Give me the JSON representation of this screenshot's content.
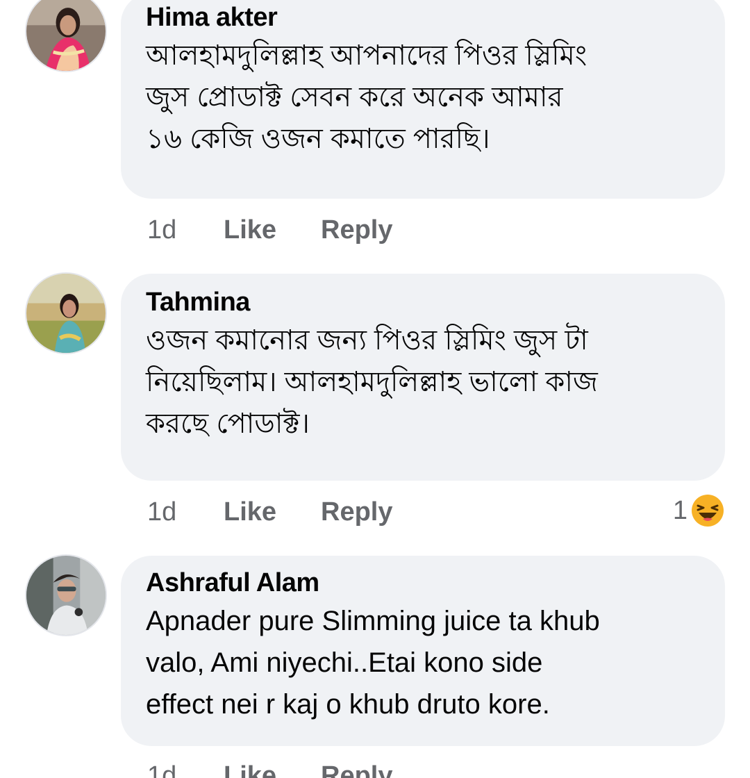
{
  "comments": [
    {
      "author": "Hima akter",
      "text": "আলহামদুলিল্লাহ আপনাদের পিওর স্লিমিং\nজুস প্রোডাক্ট সেবন করে অনেক আমার\n১৬ কেজি ওজন কমাতে পারছি।",
      "time": "1d",
      "like_label": "Like",
      "reply_label": "Reply"
    },
    {
      "author": "Tahmina",
      "text": "ওজন কমানোর জন্য পিওর স্লিমিং জুস টা\nনিয়েছিলাম। আলহামদুলিল্লাহ ভালো কাজ\nকরছে পোডাক্ট।",
      "time": "1d",
      "like_label": "Like",
      "reply_label": "Reply",
      "reaction_count": "1",
      "reaction_icon": "haha-emoji-icon"
    },
    {
      "author": "Ashraful Alam",
      "text": "Apnader pure Slimming  juice ta khub\nvalo, Ami niyechi..Etai kono side\neffect nei r kaj o khub druto kore.",
      "time": "1d",
      "like_label": "Like",
      "reply_label": "Reply"
    }
  ],
  "colors": {
    "bubble": "#f0f2f5",
    "text": "#050505",
    "secondary": "#65676b"
  }
}
